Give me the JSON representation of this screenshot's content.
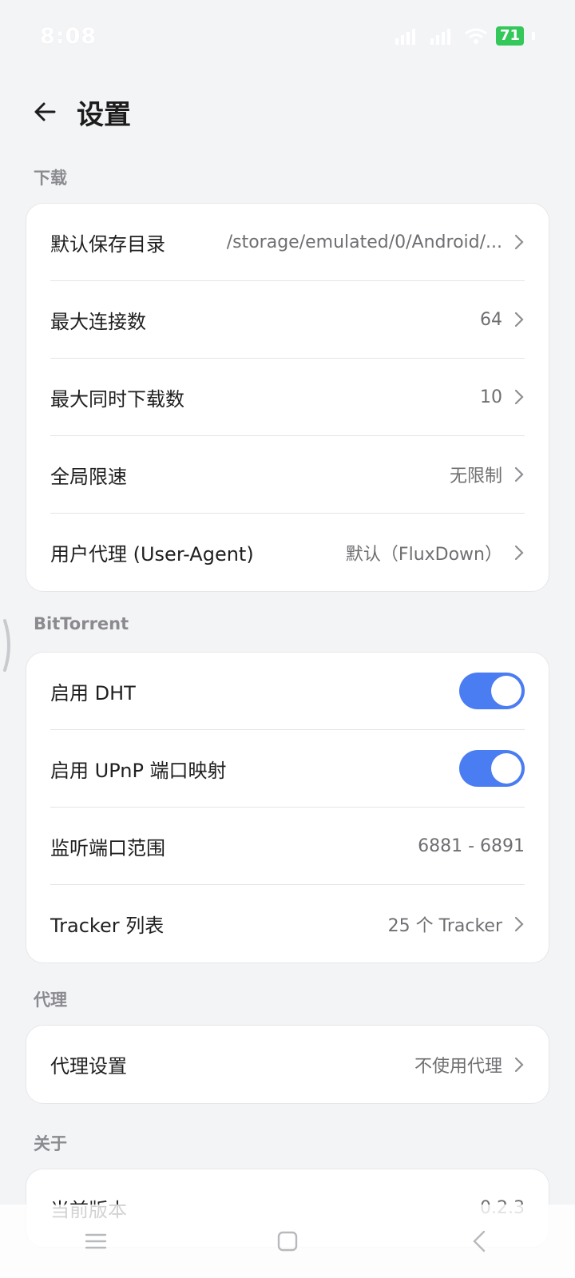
{
  "status_bar": {
    "time": "8:08",
    "battery": "71",
    "icons": [
      "signal-icon",
      "signal-icon",
      "wifi-icon",
      "battery-icon"
    ]
  },
  "header": {
    "title": "设置",
    "back_icon": "arrow-left-icon"
  },
  "sections": {
    "download": {
      "label": "下载",
      "rows": [
        {
          "label": "默认保存目录",
          "value": "/storage/emulated/0/Android/..."
        },
        {
          "label": "最大连接数",
          "value": "64"
        },
        {
          "label": "最大同时下载数",
          "value": "10"
        },
        {
          "label": "全局限速",
          "value": "无限制"
        },
        {
          "label": "用户代理 (User-Agent)",
          "value": "默认（FluxDown）"
        }
      ]
    },
    "bittorrent": {
      "label": "BitTorrent",
      "rows": [
        {
          "label": "启用 DHT",
          "toggle": true
        },
        {
          "label": "启用 UPnP 端口映射",
          "toggle": true
        },
        {
          "label": "监听端口范围",
          "value": "6881 - 6891"
        },
        {
          "label": "Tracker 列表",
          "value": "25 个 Tracker"
        }
      ]
    },
    "proxy": {
      "label": "代理",
      "rows": [
        {
          "label": "代理设置",
          "value": "不使用代理"
        }
      ]
    },
    "about": {
      "label": "关于",
      "rows": [
        {
          "label": "当前版本",
          "value": "0.2.3"
        }
      ]
    }
  },
  "colors": {
    "accent": "#4a7cf2",
    "background": "#f3f4f6",
    "battery": "#34c759"
  },
  "nav": {
    "icons": [
      "menu-icon",
      "home-square-icon",
      "back-chevron-icon"
    ]
  }
}
